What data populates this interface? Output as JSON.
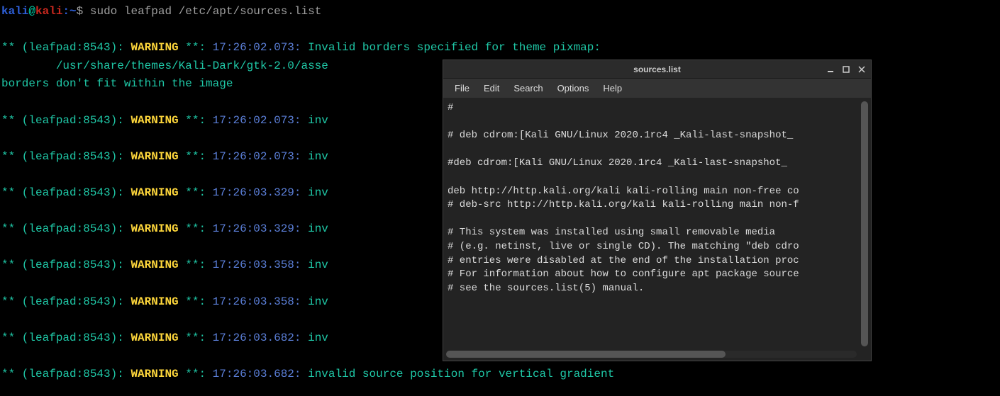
{
  "terminal": {
    "prompt": {
      "user": "kali",
      "at": "@",
      "host": "kali",
      "sep": ":",
      "path": "~",
      "dollar": "$",
      "command": "sudo leafpad /etc/apt/sources.list"
    },
    "lines": [
      {
        "prefix": "** (leafpad:8543): ",
        "warn": "WARNING",
        "star": " **: ",
        "time": "17:26:02.073:",
        "msg": " Invalid borders specified for theme pixmap:"
      },
      {
        "continuation": "        /usr/share/themes/Kali-Dark/gtk-2.0/asse"
      },
      {
        "continuation": "borders don't fit within the image"
      },
      {
        "blank": true
      },
      {
        "prefix": "** (leafpad:8543): ",
        "warn": "WARNING",
        "star": " **: ",
        "time": "17:26:02.073:",
        "msg": " inv"
      },
      {
        "blank": true
      },
      {
        "prefix": "** (leafpad:8543): ",
        "warn": "WARNING",
        "star": " **: ",
        "time": "17:26:02.073:",
        "msg": " inv"
      },
      {
        "blank": true
      },
      {
        "prefix": "** (leafpad:8543): ",
        "warn": "WARNING",
        "star": " **: ",
        "time": "17:26:03.329:",
        "msg": " inv"
      },
      {
        "blank": true
      },
      {
        "prefix": "** (leafpad:8543): ",
        "warn": "WARNING",
        "star": " **: ",
        "time": "17:26:03.329:",
        "msg": " inv"
      },
      {
        "blank": true
      },
      {
        "prefix": "** (leafpad:8543): ",
        "warn": "WARNING",
        "star": " **: ",
        "time": "17:26:03.358:",
        "msg": " inv"
      },
      {
        "blank": true
      },
      {
        "prefix": "** (leafpad:8543): ",
        "warn": "WARNING",
        "star": " **: ",
        "time": "17:26:03.358:",
        "msg": " inv"
      },
      {
        "blank": true
      },
      {
        "prefix": "** (leafpad:8543): ",
        "warn": "WARNING",
        "star": " **: ",
        "time": "17:26:03.682:",
        "msg": " inv"
      },
      {
        "blank": true
      },
      {
        "prefix": "** (leafpad:8543): ",
        "warn": "WARNING",
        "star": " **: ",
        "time": "17:26:03.682:",
        "msg": " invalid source position for vertical gradient"
      }
    ]
  },
  "window": {
    "title": "sources.list",
    "menus": [
      "File",
      "Edit",
      "Search",
      "Options",
      "Help"
    ],
    "content": "#\n\n# deb cdrom:[Kali GNU/Linux 2020.1rc4 _Kali-last-snapshot_\n\n#deb cdrom:[Kali GNU/Linux 2020.1rc4 _Kali-last-snapshot_\n\ndeb http://http.kali.org/kali kali-rolling main non-free co\n# deb-src http://http.kali.org/kali kali-rolling main non-f\n\n# This system was installed using small removable media\n# (e.g. netinst, live or single CD). The matching \"deb cdro\n# entries were disabled at the end of the installation proc\n# For information about how to configure apt package source\n# see the sources.list(5) manual."
  }
}
